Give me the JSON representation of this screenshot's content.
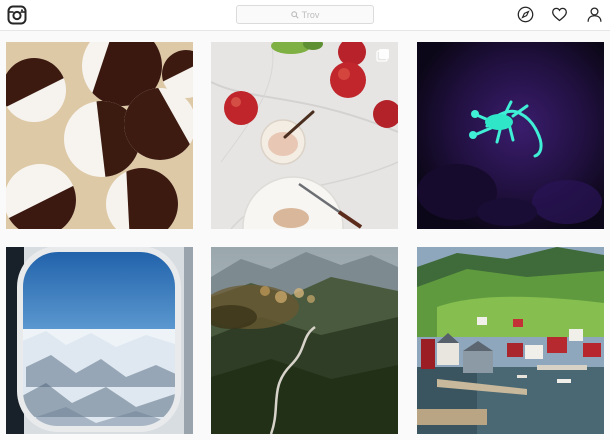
{
  "header": {
    "logo_icon": "instagram-camera-icon",
    "search": {
      "placeholder": "Trov",
      "icon": "search-icon"
    },
    "nav_icons": [
      "explore-compass-icon",
      "heart-icon",
      "profile-icon"
    ]
  },
  "feed": {
    "posts": [
      {
        "subject": "black-and-white-cookies"
      },
      {
        "subject": "apples-and-spread",
        "multi_photo_icon": "carousel-icon"
      },
      {
        "subject": "glowing-scorpion"
      },
      {
        "subject": "airplane-window-mountains"
      },
      {
        "subject": "forest-valley-road"
      },
      {
        "subject": "norwegian-harbor-village"
      }
    ]
  },
  "colors": {
    "background": "#fafafa",
    "header_bg": "#ffffff",
    "border": "#dbdbdb",
    "icon": "#262626"
  }
}
